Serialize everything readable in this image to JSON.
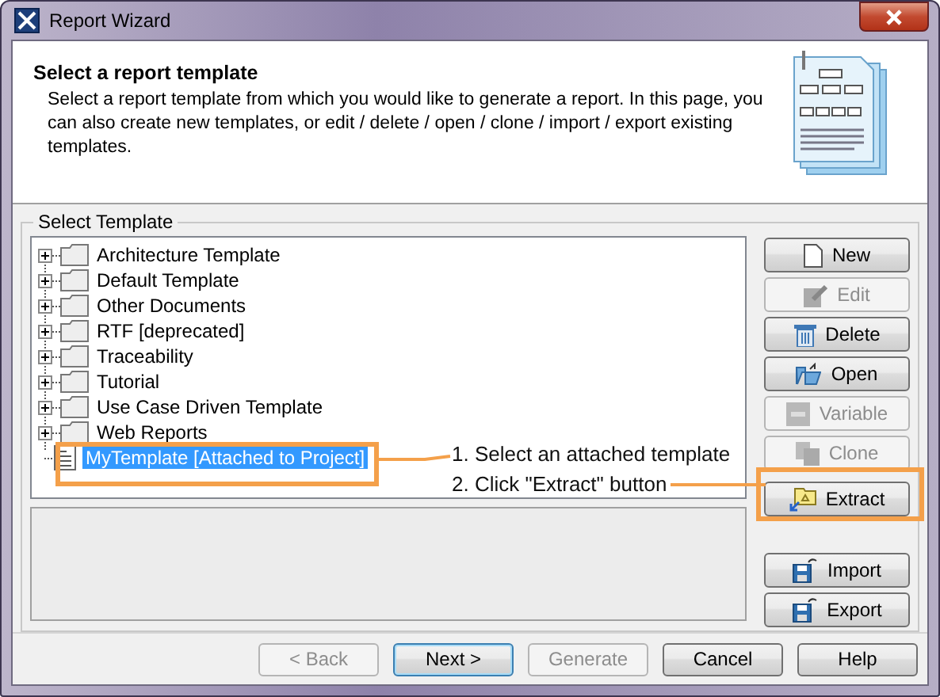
{
  "window": {
    "title": "Report Wizard"
  },
  "header": {
    "title": "Select a report template",
    "description": "Select a report template from which you would like to generate a report. In this page, you can also create new templates, or edit / delete / open / clone / import / export existing templates."
  },
  "group": {
    "title": "Select Template"
  },
  "tree": [
    {
      "label": "Architecture Template",
      "kind": "folder",
      "expanded": false,
      "selected": false
    },
    {
      "label": "Default Template",
      "kind": "folder",
      "expanded": false,
      "selected": false
    },
    {
      "label": "Other Documents",
      "kind": "folder",
      "expanded": false,
      "selected": false
    },
    {
      "label": "RTF [deprecated]",
      "kind": "folder",
      "expanded": false,
      "selected": false
    },
    {
      "label": "Traceability",
      "kind": "folder",
      "expanded": false,
      "selected": false
    },
    {
      "label": "Tutorial",
      "kind": "folder",
      "expanded": false,
      "selected": false
    },
    {
      "label": "Use Case Driven Template",
      "kind": "folder",
      "expanded": false,
      "selected": false
    },
    {
      "label": "Web Reports",
      "kind": "folder",
      "expanded": false,
      "selected": false
    },
    {
      "label": "MyTemplate [Attached to Project]",
      "kind": "template",
      "selected": true
    }
  ],
  "side_buttons": [
    {
      "label": "New",
      "disabled": false
    },
    {
      "label": "Edit",
      "disabled": true
    },
    {
      "label": "Delete",
      "disabled": false
    },
    {
      "label": "Open",
      "disabled": false
    },
    {
      "label": "Variable",
      "disabled": true
    },
    {
      "label": "Clone",
      "disabled": true
    },
    {
      "label": "Extract",
      "disabled": false
    },
    {
      "label": "Import",
      "disabled": false
    },
    {
      "label": "Export",
      "disabled": false
    }
  ],
  "annotations": [
    "1. Select an attached template",
    "2. Click \"Extract\" button"
  ],
  "footer_buttons": [
    {
      "label": "< Back",
      "disabled": true,
      "default": false
    },
    {
      "label": "Next >",
      "disabled": false,
      "default": true
    },
    {
      "label": "Generate",
      "disabled": true,
      "default": false
    },
    {
      "label": "Cancel",
      "disabled": false,
      "default": false
    },
    {
      "label": "Help",
      "disabled": false,
      "default": false
    }
  ]
}
